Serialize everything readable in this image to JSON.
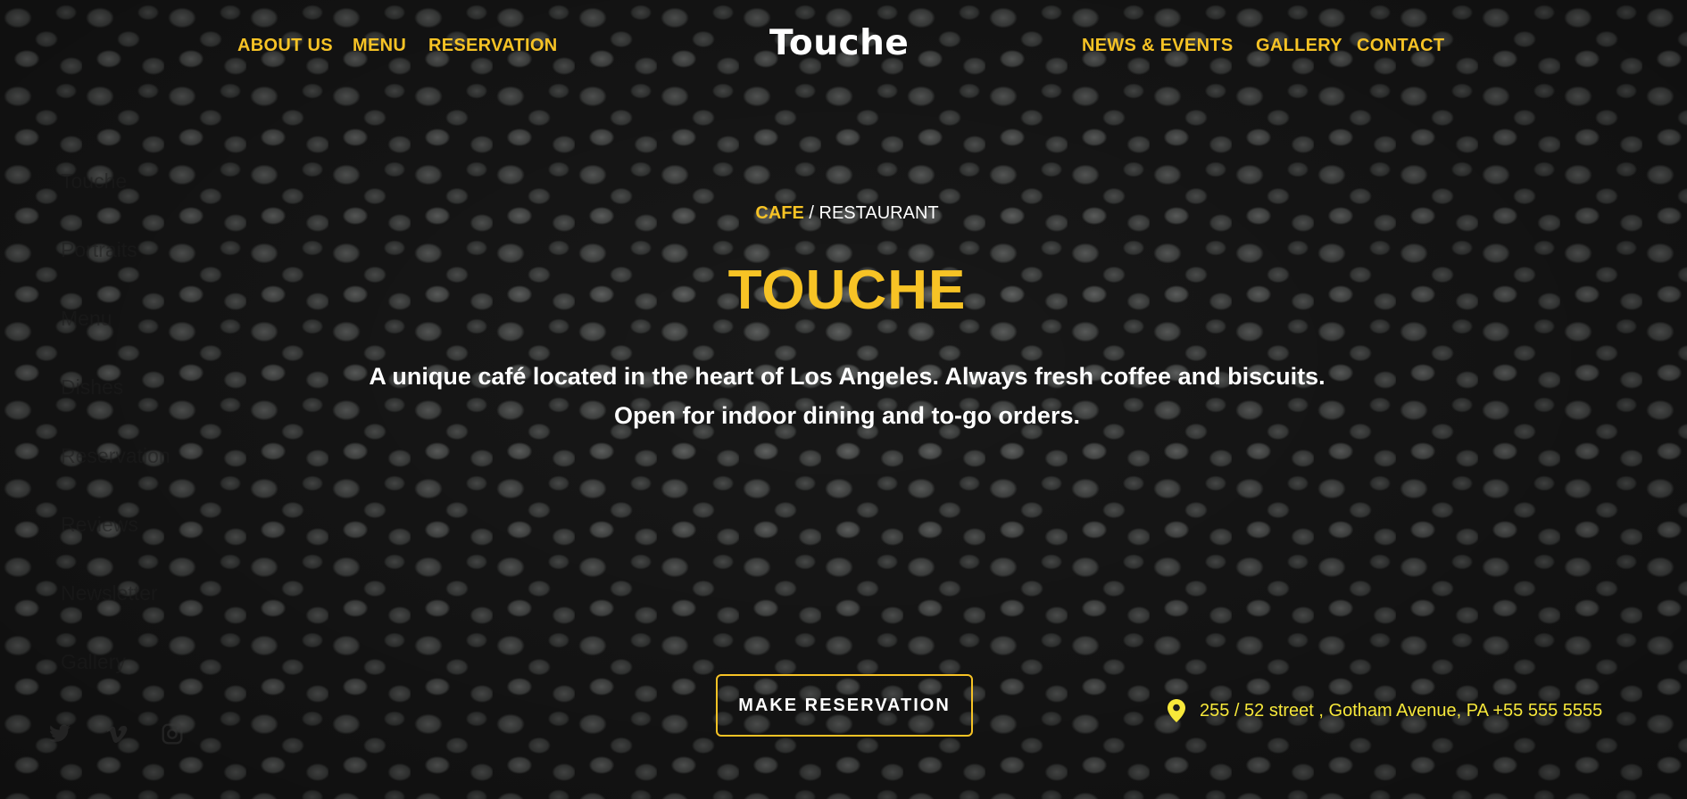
{
  "nav": {
    "left": [
      "ABOUT US",
      "MENU",
      "RESERVATION"
    ],
    "logo": "Touche",
    "right": [
      "NEWS & EVENTS",
      "GALLERY",
      "CONTACT"
    ]
  },
  "side_menu": {
    "items": [
      "Touche",
      "Portraits",
      "Menu",
      "Dishes",
      "Reservation",
      "Reviews",
      "Newsletter",
      "Gallery"
    ],
    "social_icons": [
      "twitter-icon",
      "vimeo-icon",
      "instagram-icon"
    ]
  },
  "hero": {
    "subtitle_highlight": "CAFE",
    "subtitle_rest": "/ RESTAURANT",
    "title": "TOUCHE",
    "description": "A unique café located in the heart of Los Angeles. Always fresh coffee and biscuits. Open for indoor dining and to-go orders.",
    "cta_label": "MAKE RESERVATION"
  },
  "address": {
    "icon": "map-pin-icon",
    "text": "255 / 52 street , Gotham Avenue, PA +55 555 5555"
  },
  "colors": {
    "accent": "#f7c325",
    "address_text": "#f7e83a",
    "text": "#ffffff"
  }
}
